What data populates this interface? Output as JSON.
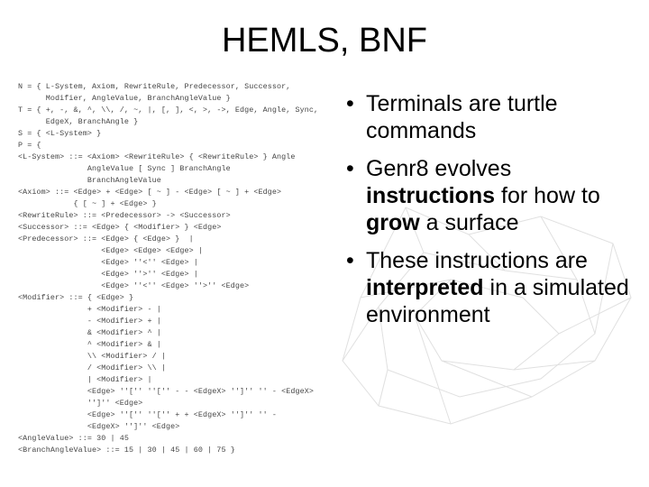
{
  "title": "HEMLS, BNF",
  "bnf": {
    "l1": "N = { L-System, Axiom, RewriteRule, Predecessor, Successor,",
    "l2": "      Modifier, AngleValue, BranchAngleValue }",
    "l3": "T = { +, -, &, ^, \\\\, /, ~, |, [, ], <, >, ->, Edge, Angle, Sync,",
    "l4": "      EdgeX, BranchAngle }",
    "l5": "S = { <L-System> }",
    "l6": "P = {",
    "l7": "<L-System> ::= <Axiom> <RewriteRule> { <RewriteRule> } Angle",
    "l8": "               AngleValue [ Sync ] BranchAngle",
    "l9": "               BranchAngleValue",
    "l10": "<Axiom> ::= <Edge> + <Edge> [ ~ ] - <Edge> [ ~ ] + <Edge>",
    "l11": "            { [ ~ ] + <Edge> }",
    "l12": "<RewriteRule> ::= <Predecessor> -> <Successor>",
    "l13": "<Successor> ::= <Edge> { <Modifier> } <Edge>",
    "l14": "<Predecessor> ::= <Edge> { <Edge> }  |",
    "l15": "                  <Edge> <Edge> <Edge> |",
    "l16": "                  <Edge> ''<'' <Edge> |",
    "l17": "                  <Edge> ''>'' <Edge> |",
    "l18": "                  <Edge> ''<'' <Edge> ''>'' <Edge>",
    "l19": "<Modifier> ::= { <Edge> }",
    "l20": "               + <Modifier> - |",
    "l21": "               - <Modifier> + |",
    "l22": "               & <Modifier> ^ |",
    "l23": "               ^ <Modifier> & |",
    "l24": "               \\\\ <Modifier> / |",
    "l25": "               / <Modifier> \\\\ |",
    "l26": "               | <Modifier> |",
    "l27": "               <Edge> ''['' ''['' - - <EdgeX> '']'' '' - <EdgeX>",
    "l28": "               '']'' <Edge>",
    "l29": "               <Edge> ''['' ''['' + + <EdgeX> '']'' '' -",
    "l30": "               <EdgeX> '']'' <Edge>",
    "l31": "<AngleValue> ::= 30 | 45",
    "l32": "<BranchAngleValue> ::= 15 | 30 | 45 | 60 | 75 }"
  },
  "bullets": {
    "b1": {
      "pre": "Terminals are turtle commands"
    },
    "b2": {
      "pre": "Genr8 evolves ",
      "s1": "instructions",
      "mid": " for how to ",
      "s2": "grow",
      "post": " a surface"
    },
    "b3": {
      "pre": "These instructions are ",
      "s1": "interpreted",
      "post": " in a simulated environment"
    }
  }
}
